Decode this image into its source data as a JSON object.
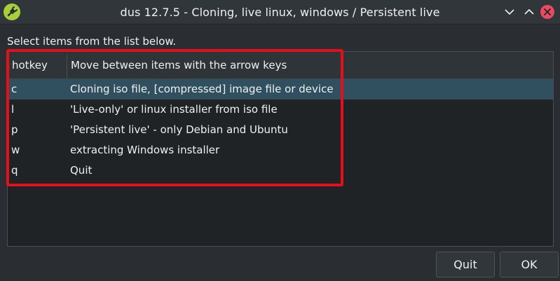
{
  "window": {
    "title": "dus 12.7.5 - Cloning, live linux, windows / Persistent live",
    "app_icon": "usb-plug-icon",
    "accent_icon_color": "#a6cf3a",
    "close_color": "#e84a5f"
  },
  "prompt": "Select items from the list below.",
  "list": {
    "columns": [
      "hotkey",
      "Move between items with the arrow keys"
    ],
    "rows": [
      {
        "hotkey": "c",
        "description": "Cloning iso file, [compressed] image file or device",
        "selected": true
      },
      {
        "hotkey": "l",
        "description": "'Live-only' or linux installer from iso file",
        "selected": false
      },
      {
        "hotkey": "p",
        "description": "'Persistent live' - only Debian and Ubuntu",
        "selected": false
      },
      {
        "hotkey": "w",
        "description": "extracting Windows installer",
        "selected": false
      },
      {
        "hotkey": "q",
        "description": "Quit",
        "selected": false
      }
    ],
    "selection_color": "#31505f",
    "annotation_box_color": "#e3101c"
  },
  "buttons": {
    "quit_label": "Quit",
    "ok_label": "OK"
  }
}
